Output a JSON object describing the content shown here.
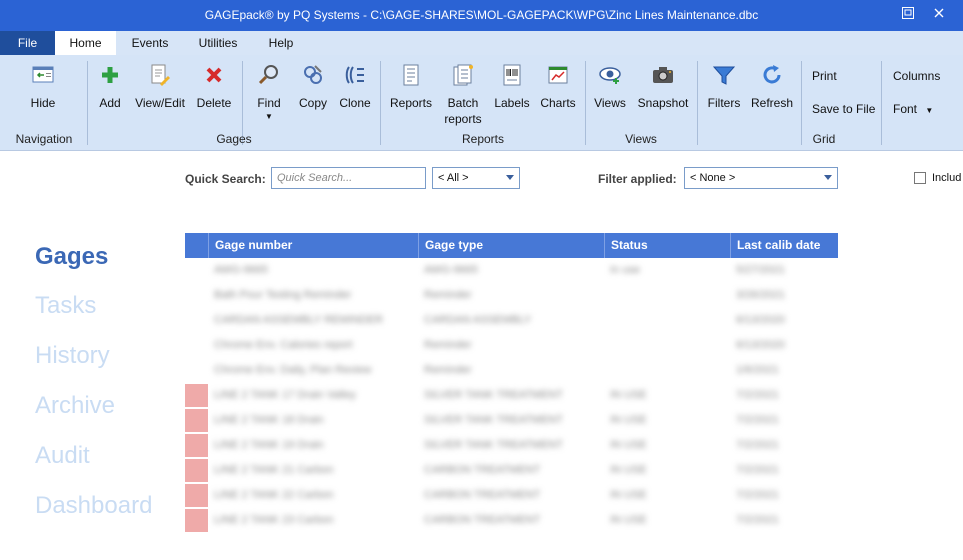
{
  "window": {
    "title": "GAGEpack® by PQ Systems - C:\\GAGE-SHARES\\MOL-GAGEPACK\\WPG\\Zinc Lines Maintenance.dbc",
    "restore_icon": "restore-icon",
    "close_icon": "close-icon"
  },
  "menu": {
    "file": "File",
    "tabs": [
      "Home",
      "Events",
      "Utilities",
      "Help"
    ]
  },
  "ribbon": {
    "hide": "Hide",
    "add": "Add",
    "view_edit": "View/Edit",
    "delete": "Delete",
    "find": "Find",
    "copy": "Copy",
    "clone": "Clone",
    "reports": "Reports",
    "batch_reports": "Batch reports",
    "labels": "Labels",
    "charts": "Charts",
    "views": "Views",
    "snapshot": "Snapshot",
    "filters": "Filters",
    "refresh": "Refresh",
    "print": "Print",
    "save_to_file": "Save to File",
    "columns": "Columns",
    "font": "Font",
    "groups": {
      "navigation": "Navigation",
      "gages": "Gages",
      "reports": "Reports",
      "views": "Views",
      "grid": "Grid"
    }
  },
  "search": {
    "label": "Quick Search:",
    "placeholder": "Quick Search...",
    "scope": "< All >",
    "filter_label": "Filter applied:",
    "filter_value": "< None >",
    "include_label": "Includ"
  },
  "nav": {
    "items": [
      "Gages",
      "Tasks",
      "History",
      "Archive",
      "Audit",
      "Dashboard"
    ],
    "active": "Gages"
  },
  "grid": {
    "columns": [
      "Gage number",
      "Gage type",
      "Status",
      "Last calib date"
    ],
    "rows": [
      {
        "cells": [
          "AWG-9665",
          "AWG-9665",
          "In use",
          "5/27/2021"
        ],
        "flag": false
      },
      {
        "cells": [
          "Bath Pour Testing Reminder",
          "Reminder",
          "",
          "3/26/2021"
        ],
        "flag": false
      },
      {
        "cells": [
          "CARDAN ASSEMBLY REMINDER",
          "CARDAN ASSEMBLY",
          "",
          "6/13/2020"
        ],
        "flag": false
      },
      {
        "cells": [
          "Chrome Env. Calories report",
          "Reminder",
          "",
          "6/13/2020"
        ],
        "flag": false
      },
      {
        "cells": [
          "Chrome Env. Daily, Plan Review",
          "Reminder",
          "",
          "1/6/2021"
        ],
        "flag": false
      },
      {
        "cells": [
          "LINE 2 TANK 17 Drain Valley",
          "SILVER TANK TREATMENT",
          "IN USE",
          "7/2/2021"
        ],
        "flag": true
      },
      {
        "cells": [
          "LINE 2 TANK 18 Drain",
          "SILVER TANK TREATMENT",
          "IN USE",
          "7/2/2021"
        ],
        "flag": true
      },
      {
        "cells": [
          "LINE 2 TANK 19 Drain",
          "SILVER TANK TREATMENT",
          "IN USE",
          "7/2/2021"
        ],
        "flag": true
      },
      {
        "cells": [
          "LINE 2 TANK 21 Carbon",
          "CARBON TREATMENT",
          "IN USE",
          "7/2/2021"
        ],
        "flag": true
      },
      {
        "cells": [
          "LINE 2 TANK 22 Carbon",
          "CARBON TREATMENT",
          "IN USE",
          "7/2/2021"
        ],
        "flag": true
      },
      {
        "cells": [
          "LINE 2 TANK 23 Carbon",
          "CARBON TREATMENT",
          "IN USE",
          "7/2/2021"
        ],
        "flag": true
      }
    ]
  },
  "colors": {
    "titlebar": "#2b63d4",
    "ribbon": "#d5e4f7",
    "grid_header": "#4778d6",
    "flag": "#efaaa9",
    "nav_active": "#3b68b5",
    "nav_inactive": "#c9dcf3"
  }
}
